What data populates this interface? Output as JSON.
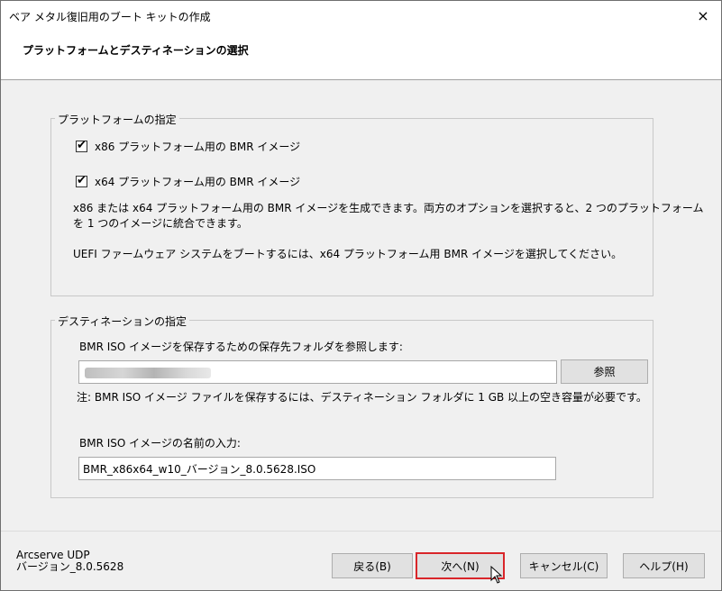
{
  "window": {
    "title": "ベア メタル復旧用のブート キットの作成",
    "close_icon": "×"
  },
  "header": {
    "title": "プラットフォームとデスティネーションの選択"
  },
  "platform_group": {
    "legend": "プラットフォームの指定",
    "x86_label": "x86 プラットフォーム用の BMR イメージ",
    "x86_checked": true,
    "x64_label": "x64 プラットフォーム用の BMR イメージ",
    "x64_checked": true,
    "description_line1": "x86 または x64 プラットフォーム用の BMR イメージを生成できます。両方のオプションを選択すると、2 つのプラットフォーム",
    "description_line2": "を 1 つのイメージに統合できます。",
    "uefi_note": "UEFI ファームウェア システムをブートするには、x64 プラットフォーム用 BMR イメージを選択してください。"
  },
  "destination_group": {
    "legend": "デスティネーションの指定",
    "folder_label": "BMR ISO イメージを保存するための保存先フォルダを参照します:",
    "folder_value": "",
    "browse_label": "参照",
    "note": "注: BMR ISO イメージ ファイルを保存するには、デスティネーション フォルダに 1 GB 以上の空き容量が必要です。",
    "name_label": "BMR ISO イメージの名前の入力:",
    "name_value": "BMR_x86x64_w10_バージョン_8.0.5628.ISO"
  },
  "footer": {
    "product": "Arcserve UDP",
    "version": "バージョン_8.0.5628",
    "back_label": "戻る(B)",
    "next_label": "次へ(N)",
    "cancel_label": "キャンセル(C)",
    "help_label": "ヘルプ(H)"
  },
  "colors": {
    "focus_border": "#d9262a",
    "window_bg": "#f0f0f0"
  }
}
